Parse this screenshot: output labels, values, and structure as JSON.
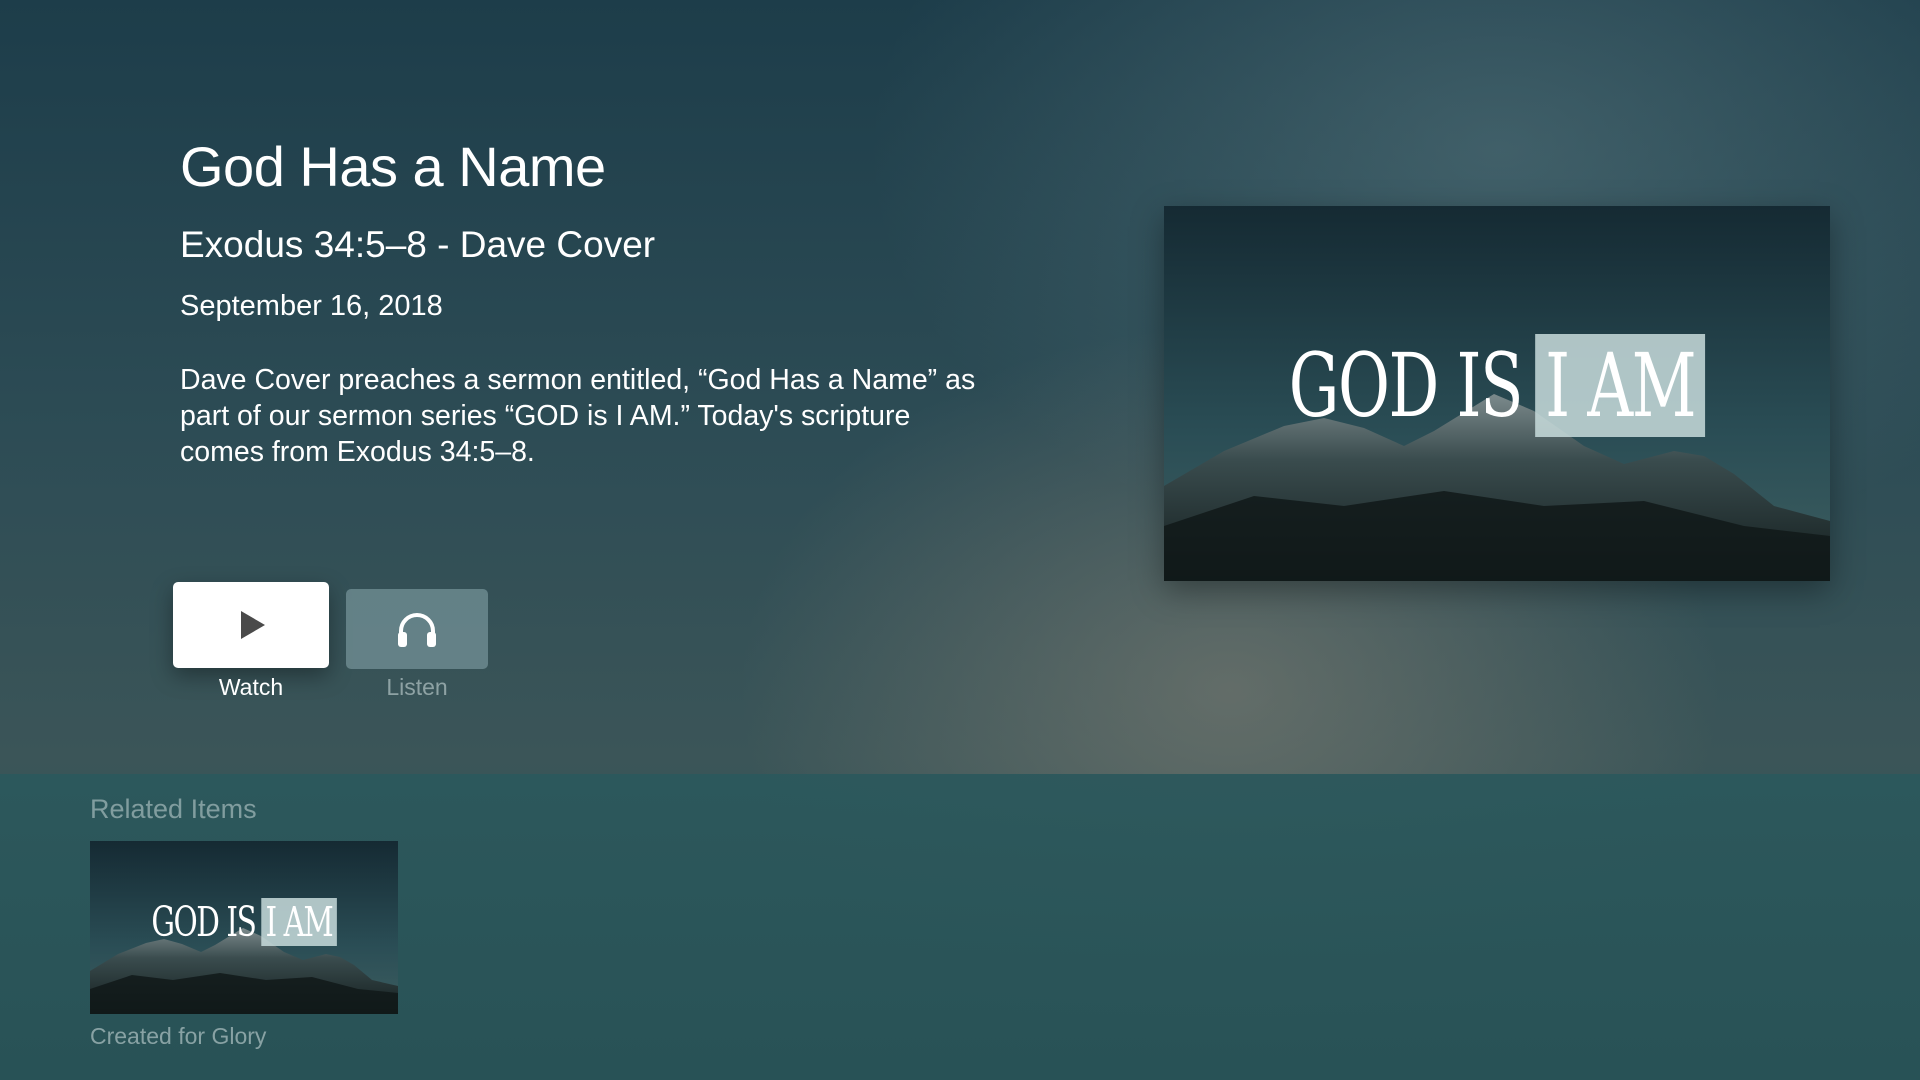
{
  "item": {
    "title": "God Has a Name",
    "subtitle": "Exodus 34:5–8 - Dave Cover",
    "date": "September 16, 2018",
    "description": "Dave Cover preaches a sermon entitled, “God Has a Name” as part of our sermon series “GOD is I AM.” Today's scripture comes from Exodus 34:5–8.",
    "artwork": {
      "text_left": "GOD IS",
      "text_boxed": "I AM"
    }
  },
  "actions": {
    "watch_label": "Watch",
    "watch_icon": "play-icon",
    "listen_label": "Listen",
    "listen_icon": "headphones-icon"
  },
  "related": {
    "title": "Related Items",
    "items": [
      {
        "caption": "Created for Glory",
        "text_left": "GOD IS",
        "text_boxed": "I AM"
      }
    ]
  },
  "colors": {
    "background_top": "#1d3d4a",
    "bottom_band": "#2c585c",
    "button_focused": "#ffffff",
    "button_unfocused": "#6f9196"
  }
}
